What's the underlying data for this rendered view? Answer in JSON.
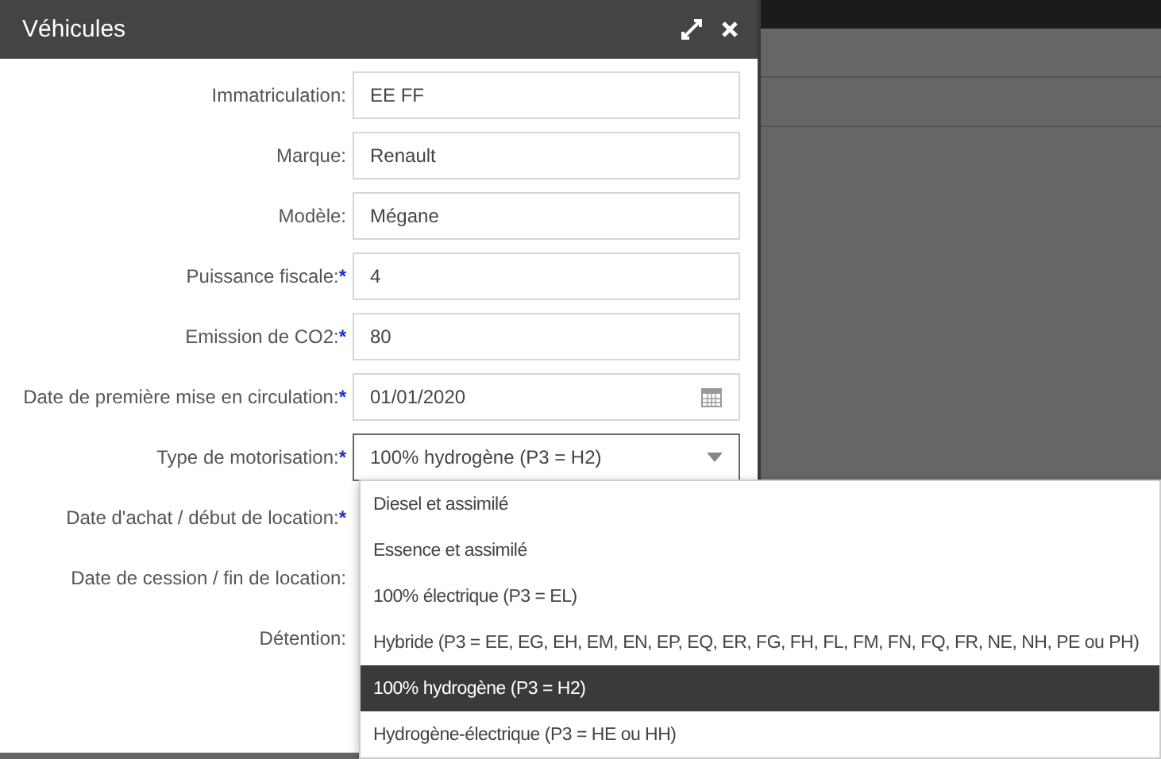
{
  "window": {
    "title": "Véhicules"
  },
  "fields": [
    {
      "label": "Immatriculation:",
      "kind": "text",
      "value": "EE FF"
    },
    {
      "label": "Marque:",
      "kind": "text",
      "value": "Renault"
    },
    {
      "label": "Modèle:",
      "kind": "text",
      "value": "Mégane"
    },
    {
      "label": "Puissance fiscale:",
      "marker": "*",
      "kind": "text",
      "value": "4"
    },
    {
      "label": "Emission de CO2:",
      "marker": "*",
      "kind": "text",
      "value": "80"
    },
    {
      "label": "Date de première mise en circulation:",
      "marker": "*",
      "kind": "date",
      "value": "01/01/2020"
    },
    {
      "label": "Type de motorisation:",
      "marker": "*",
      "kind": "select",
      "value": "100% hydrogène (P3 = H2)"
    },
    {
      "label": "Date d'achat / début de location:",
      "marker": "*"
    },
    {
      "label": "Date de cession / fin de location:"
    },
    {
      "label": "Détention:"
    }
  ],
  "dropdown": {
    "options": [
      {
        "label": "Diesel et assimilé",
        "selected": false
      },
      {
        "label": "Essence et assimilé",
        "selected": false
      },
      {
        "label": "100% électrique (P3 = EL)",
        "selected": false
      },
      {
        "label": "Hybride (P3 = EE, EG, EH, EM, EN, EP, EQ, ER, FG, FH, FL, FM, FN, FQ, FR, NE, NH, PE ou PH)",
        "selected": false
      },
      {
        "label": "100% hydrogène (P3 = H2)",
        "selected": true
      },
      {
        "label": "Hydrogène-électrique (P3 = HE ou HH)",
        "selected": false
      }
    ]
  }
}
